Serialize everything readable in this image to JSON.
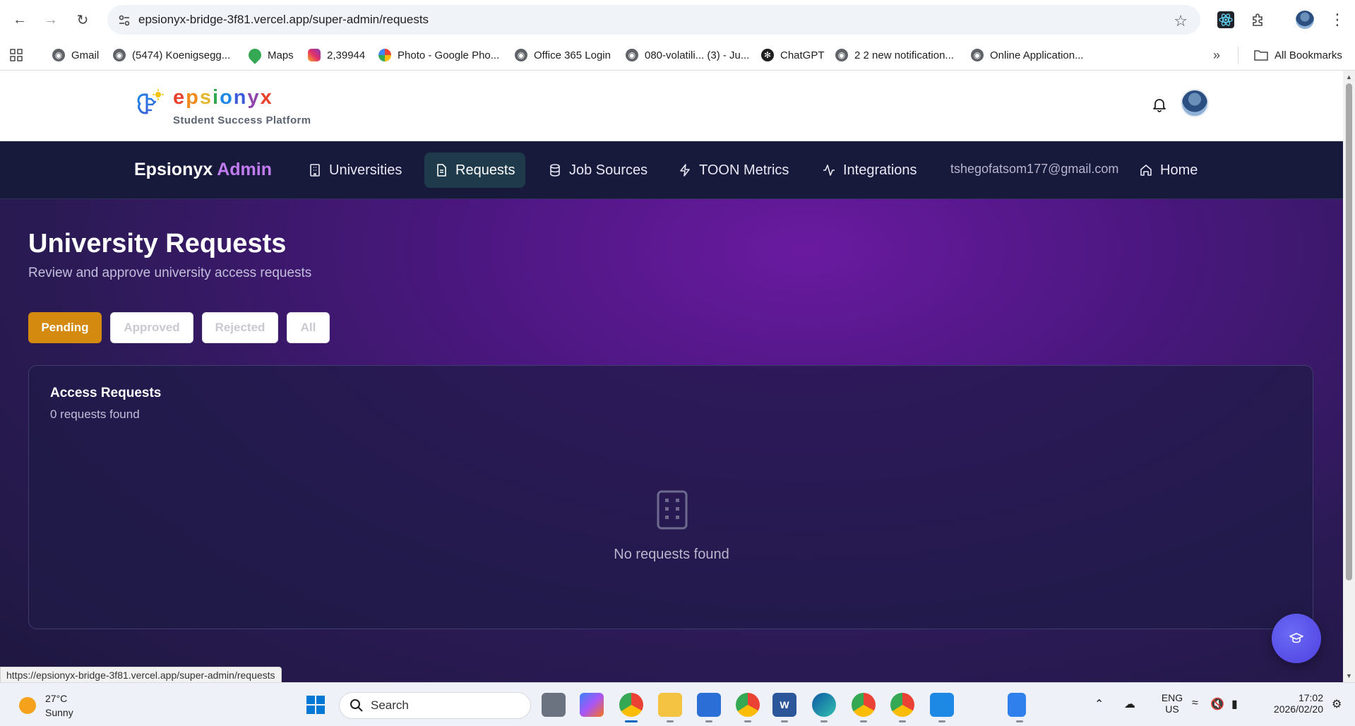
{
  "browser": {
    "url": "epsionyx-bridge-3f81.vercel.app/super-admin/requests",
    "status_url": "https://epsionyx-bridge-3f81.vercel.app/super-admin/requests",
    "bookmarks": [
      {
        "label": "Gmail",
        "icon": "globe-icon"
      },
      {
        "label": "(5474) Koenigsegg...",
        "icon": "globe-icon"
      },
      {
        "label": "Maps",
        "icon": "maps-pin-icon"
      },
      {
        "label": "2,39944",
        "icon": "instagram-icon"
      },
      {
        "label": "Photo - Google Pho...",
        "icon": "google-photos-icon"
      },
      {
        "label": "Office 365 Login",
        "icon": "globe-icon"
      },
      {
        "label": "080-volatili... (3) - Ju...",
        "icon": "globe-icon"
      },
      {
        "label": "ChatGPT",
        "icon": "chatgpt-icon"
      },
      {
        "label": "2 2 new notification...",
        "icon": "globe-icon"
      },
      {
        "label": "Online Application...",
        "icon": "globe-icon"
      }
    ],
    "all_bookmarks": "All Bookmarks"
  },
  "header": {
    "brand_letters": [
      "e",
      "p",
      "s",
      "i",
      "o",
      "n",
      "y",
      "x"
    ],
    "brand_colors": [
      "#e8412c",
      "#f18a1c",
      "#e4b62d",
      "#2fa84f",
      "#1e88e5",
      "#3b5bdb",
      "#8e44ad",
      "#e8412c"
    ],
    "tagline": "Student Success Platform"
  },
  "admin_nav": {
    "brand": "Epsionyx",
    "brand_accent": "Admin",
    "items": [
      {
        "label": "Universities",
        "icon": "building-icon"
      },
      {
        "label": "Requests",
        "icon": "document-icon",
        "active": true
      },
      {
        "label": "Job Sources",
        "icon": "database-icon"
      },
      {
        "label": "TOON Metrics",
        "icon": "lightning-icon"
      },
      {
        "label": "Integrations",
        "icon": "activity-icon"
      }
    ],
    "email": "tshegofatsom177@gmail.com",
    "home": "Home"
  },
  "main": {
    "title": "University Requests",
    "subtitle": "Review and approve university access requests",
    "filters": [
      "Pending",
      "Approved",
      "Rejected",
      "All"
    ],
    "active_filter": "Pending",
    "card_title": "Access Requests",
    "card_count": "0 requests found",
    "empty_text": "No requests found"
  },
  "taskbar": {
    "temperature": "27°C",
    "condition": "Sunny",
    "search": "Search",
    "language_top": "ENG",
    "language_bottom": "US",
    "time": "17:02",
    "date": "2026/02/20"
  },
  "colors": {
    "accent_purple": "#c07cf0",
    "pending": "#d48a0f",
    "nav_bg": "#171a3a"
  }
}
